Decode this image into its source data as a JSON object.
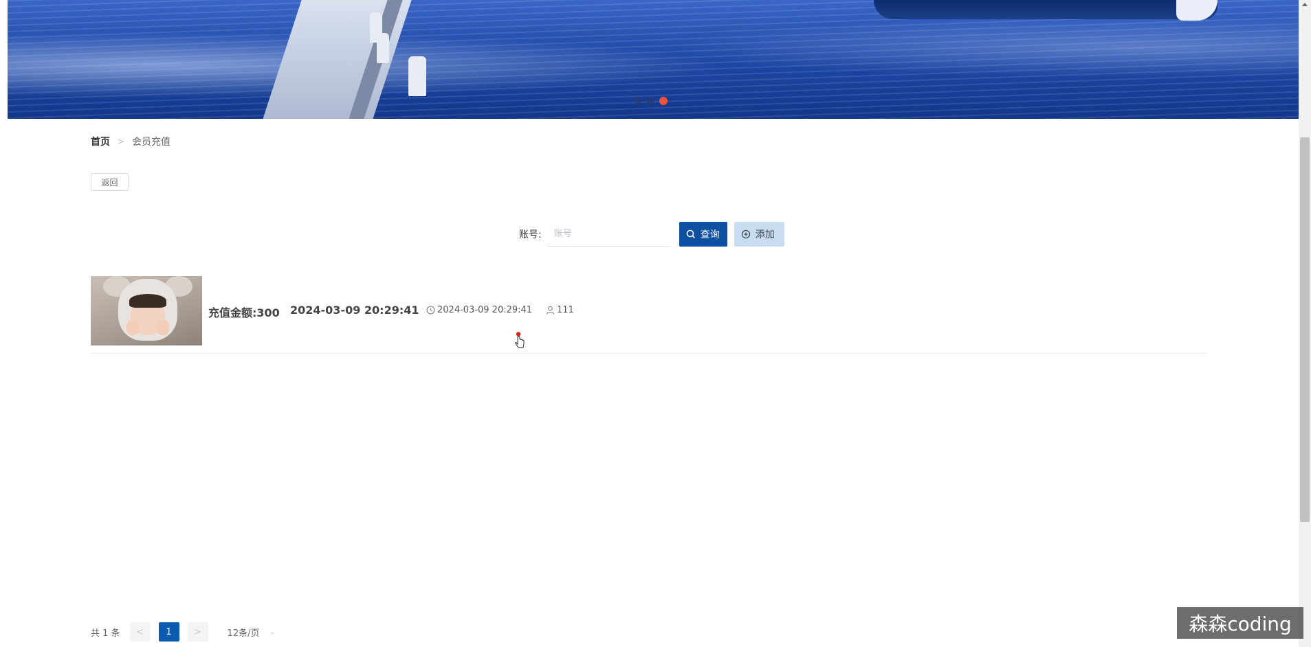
{
  "banner": {
    "active_slide": 3,
    "slide_count": 3
  },
  "breadcrumb": {
    "home": "首页",
    "separator": ">",
    "current": "会员充值"
  },
  "back_button": "返回",
  "search": {
    "label": "账号:",
    "placeholder": "账号",
    "value": "",
    "query_button": "查询",
    "add_button": "添加"
  },
  "records": [
    {
      "amount_label": "充值金额:300",
      "date_bold": "2024-03-09 20:29:41",
      "time": "2024-03-09 20:29:41",
      "user": "111",
      "icons": [
        "clock-icon",
        "user-icon"
      ]
    }
  ],
  "pagination": {
    "total_text": "共 1 条",
    "prev": "<",
    "current_page": "1",
    "next": ">",
    "page_size": "12条/页"
  },
  "watermark": "森森coding",
  "colors": {
    "primary": "#0d4fa0",
    "add_button_bg": "#c9dcf0",
    "active_dot": "#f0533a"
  }
}
